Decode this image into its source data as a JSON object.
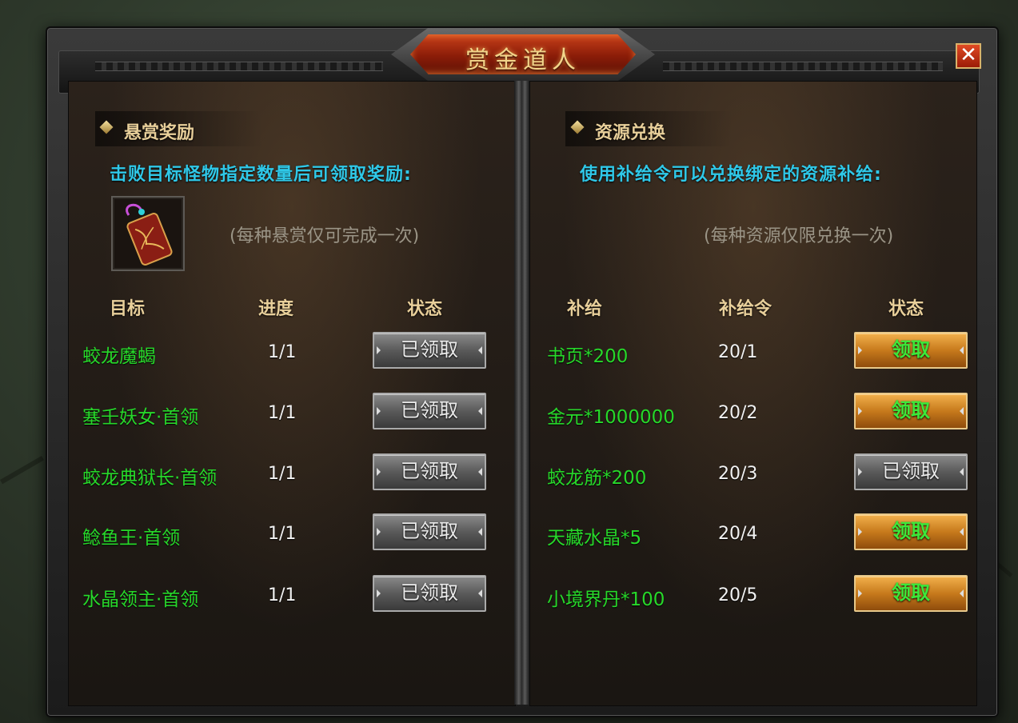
{
  "window": {
    "title": "赏金道人",
    "close_symbol": "✕"
  },
  "left": {
    "heading": "悬赏奖励",
    "description": "击败目标怪物指定数量后可领取奖励:",
    "note": "(每种悬赏仅可完成一次)",
    "columns": [
      "目标",
      "进度",
      "状态"
    ],
    "rows": [
      {
        "target": "蛟龙魔蝎",
        "progress": "1/1",
        "status": "已领取"
      },
      {
        "target": "塞壬妖女·首领",
        "progress": "1/1",
        "status": "已领取"
      },
      {
        "target": "蛟龙典狱长·首领",
        "progress": "1/1",
        "status": "已领取"
      },
      {
        "target": "鲶鱼王·首领",
        "progress": "1/1",
        "status": "已领取"
      },
      {
        "target": "水晶领主·首领",
        "progress": "1/1",
        "status": "已领取"
      }
    ]
  },
  "right": {
    "heading": "资源兑换",
    "description": "使用补给令可以兑换绑定的资源补给:",
    "note": "(每种资源仅限兑换一次)",
    "columns": [
      "补给",
      "补给令",
      "状态"
    ],
    "rows": [
      {
        "supply": "书页*200",
        "tokens": "20/1",
        "status": "领取"
      },
      {
        "supply": "金元*1000000",
        "tokens": "20/2",
        "status": "领取"
      },
      {
        "supply": "蛟龙筋*200",
        "tokens": "20/3",
        "status": "已领取"
      },
      {
        "supply": "天藏水晶*5",
        "tokens": "20/4",
        "status": "领取"
      },
      {
        "supply": "小境界丹*100",
        "tokens": "20/5",
        "status": "领取"
      }
    ]
  },
  "colors": {
    "target_text": "#27d82a",
    "description_text": "#2fc8e8",
    "heading_text": "#e8cf9a",
    "claim_button": "#c77a1c",
    "claimed_button": "#5a5a5a"
  }
}
